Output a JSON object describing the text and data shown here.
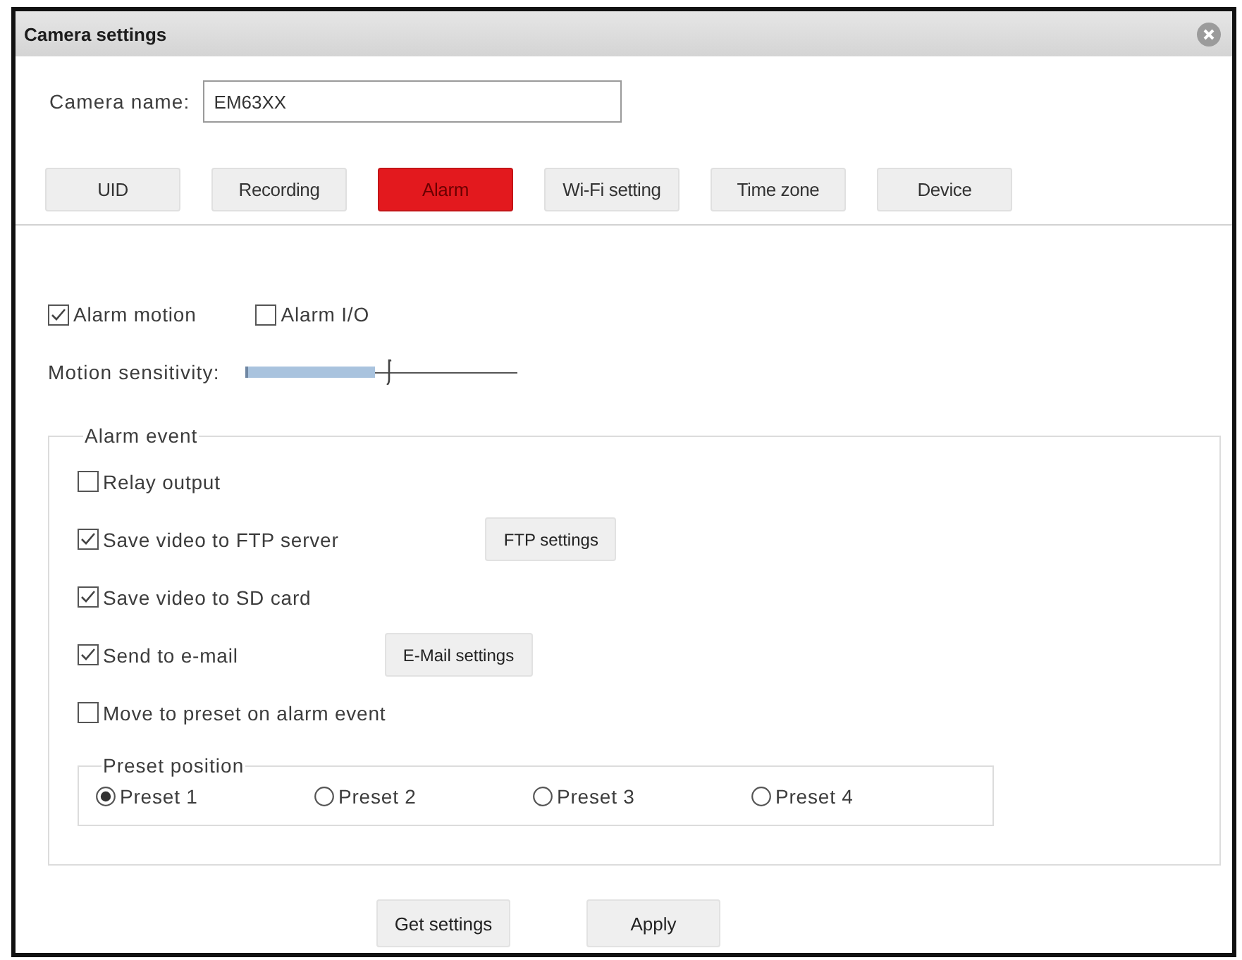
{
  "window": {
    "title": "Camera settings"
  },
  "camera_name": {
    "label": "Camera name:",
    "value": "EM63XX"
  },
  "tabs": [
    {
      "label": "UID",
      "selected": false
    },
    {
      "label": "Recording",
      "selected": false
    },
    {
      "label": "Alarm",
      "selected": true
    },
    {
      "label": "Wi-Fi setting",
      "selected": false
    },
    {
      "label": "Time zone",
      "selected": false
    },
    {
      "label": "Device",
      "selected": false
    }
  ],
  "alarm_triggers": [
    {
      "label": "Alarm motion",
      "checked": true
    },
    {
      "label": "Alarm I/O",
      "checked": false
    }
  ],
  "motion_sensitivity": {
    "label": "Motion sensitivity:",
    "level": 0.53
  },
  "alarm_event": {
    "legend": "Alarm event",
    "options": [
      {
        "label": "Relay output",
        "checked": false
      },
      {
        "label": "Save video to FTP server",
        "checked": true,
        "button": "FTP settings"
      },
      {
        "label": "Save video to SD card",
        "checked": true
      },
      {
        "label": "Send to e-mail",
        "checked": true,
        "button": "E-Mail settings"
      },
      {
        "label": "Move to preset on alarm event",
        "checked": false
      }
    ],
    "preset_position": {
      "legend": "Preset position",
      "presets": [
        {
          "label": "Preset 1",
          "selected": true
        },
        {
          "label": "Preset 2",
          "selected": false
        },
        {
          "label": "Preset 3",
          "selected": false
        },
        {
          "label": "Preset 4",
          "selected": false
        }
      ]
    }
  },
  "buttons": [
    "Get settings",
    "Apply"
  ]
}
